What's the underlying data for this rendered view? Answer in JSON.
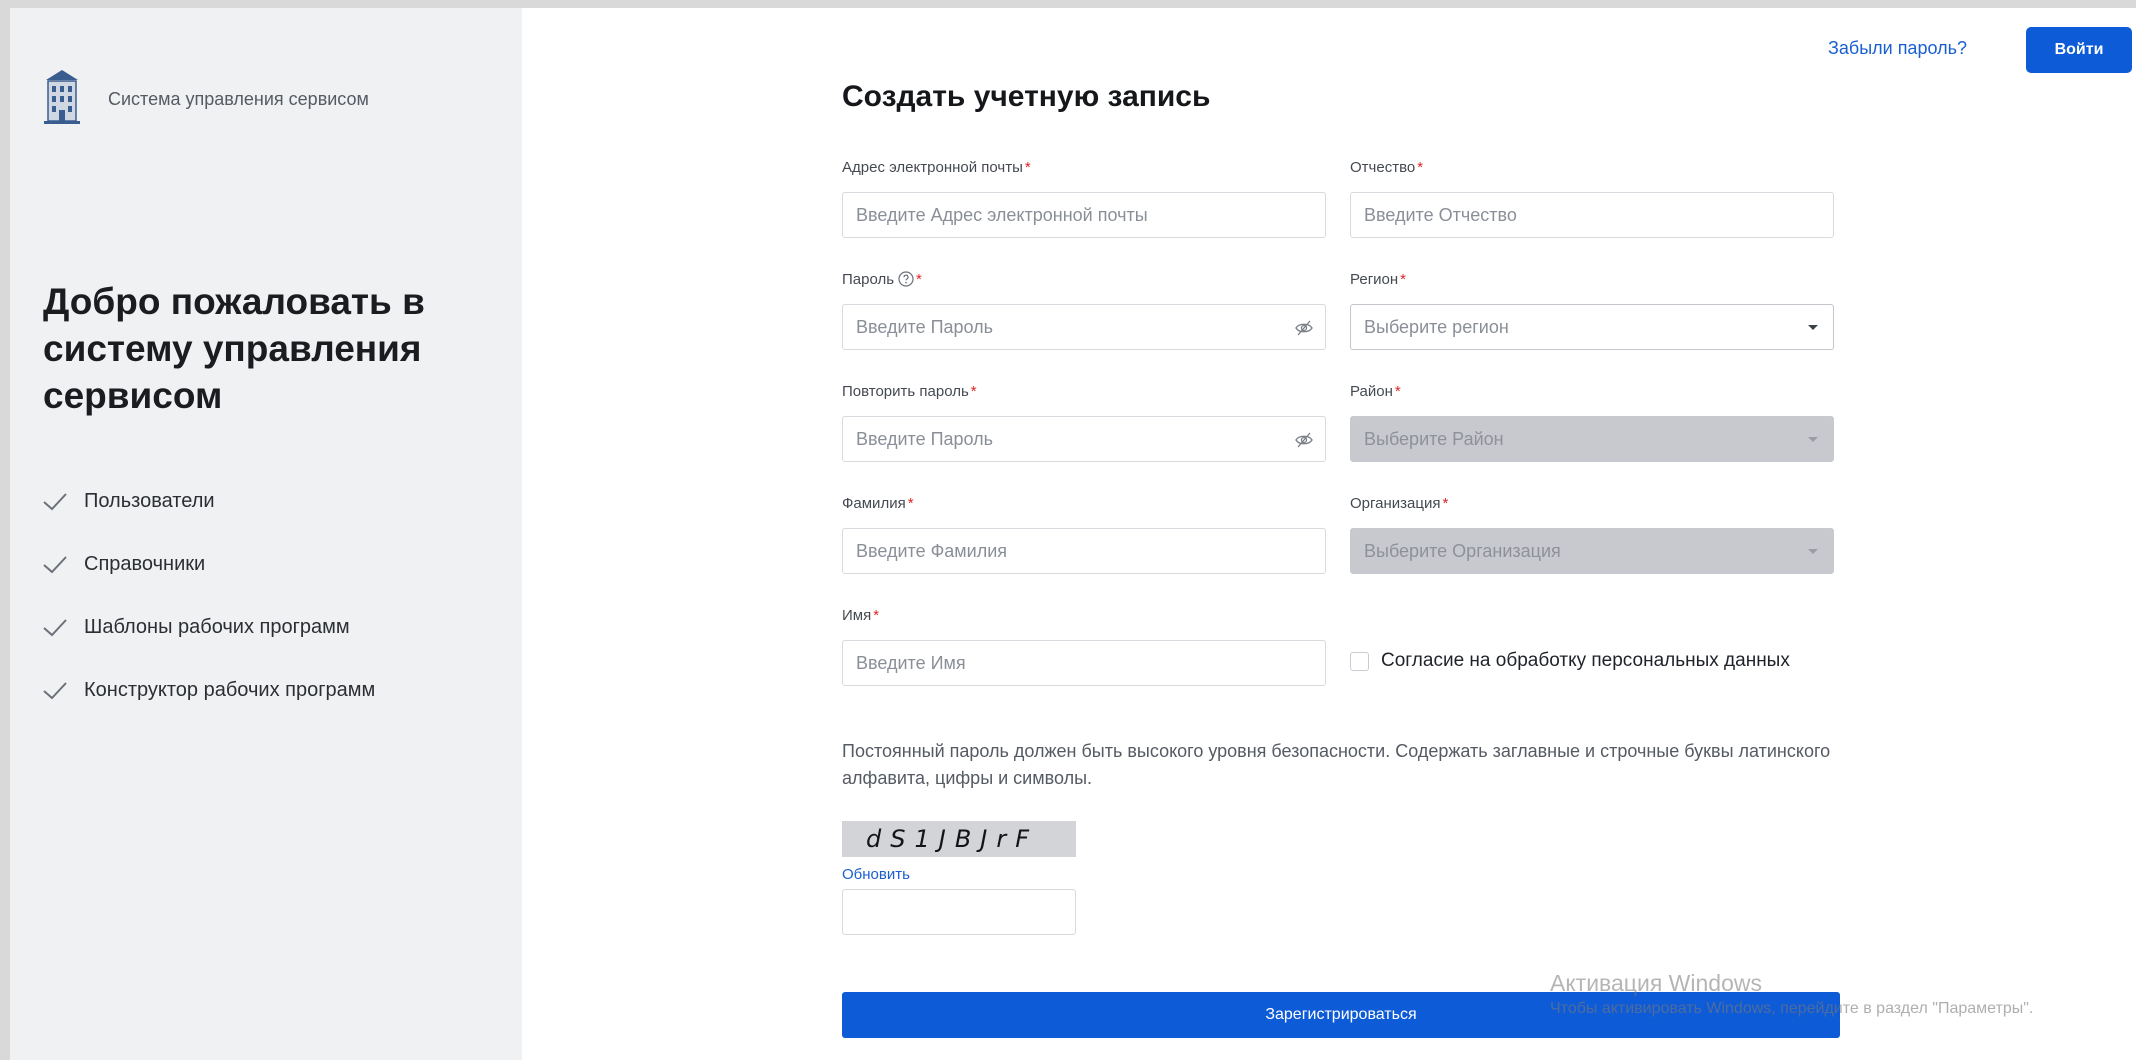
{
  "brand": {
    "name": "Система управления сервисом",
    "logo_icon": "building-icon"
  },
  "welcome": {
    "title": "Добро пожаловать в систему управления сервисом"
  },
  "features": [
    {
      "label": "Пользователи",
      "icon": "check-icon"
    },
    {
      "label": "Справочники",
      "icon": "check-icon"
    },
    {
      "label": "Шаблоны рабочих программ",
      "icon": "check-icon"
    },
    {
      "label": "Конструктор рабочих программ",
      "icon": "check-icon"
    }
  ],
  "header": {
    "forgot_password": "Забыли пароль?",
    "login_button": "Войти"
  },
  "form": {
    "title": "Создать учетную запись",
    "email": {
      "label": "Адрес электронной почты",
      "placeholder": "Введите Адрес электронной почты"
    },
    "patronymic": {
      "label": "Отчество",
      "placeholder": "Введите Отчество"
    },
    "password": {
      "label": "Пароль",
      "placeholder": "Введите Пароль"
    },
    "region": {
      "label": "Регион",
      "placeholder": "Выберите регион"
    },
    "repeat_password": {
      "label": "Повторить пароль",
      "placeholder": "Введите Пароль"
    },
    "district": {
      "label": "Район",
      "placeholder": "Выберите Район"
    },
    "surname": {
      "label": "Фамилия",
      "placeholder": "Введите Фамилия"
    },
    "organization": {
      "label": "Организация",
      "placeholder": "Выберите Организация"
    },
    "name": {
      "label": "Имя",
      "placeholder": "Введите Имя"
    },
    "consent": "Согласие на обработку персональных данных",
    "required_mark": "*",
    "policy_text": "Постоянный пароль должен быть высокого уровня безопасности. Содержать заглавные и строчные буквы латинского алфавита, цифры и символы.",
    "captcha": {
      "code": "dS1JBJrF",
      "refresh": "Обновить"
    },
    "register_button": "Зарегистрироваться"
  },
  "watermark": {
    "title": "Активация Windows",
    "subtitle": "Чтобы активировать Windows, перейдите в раздел \"Параметры\"."
  },
  "colors": {
    "primary": "#0e5bd8",
    "link": "#1a5fd1",
    "required": "#e02424",
    "panel_bg": "#f0f1f3",
    "disabled_bg": "#c7c9ce"
  }
}
